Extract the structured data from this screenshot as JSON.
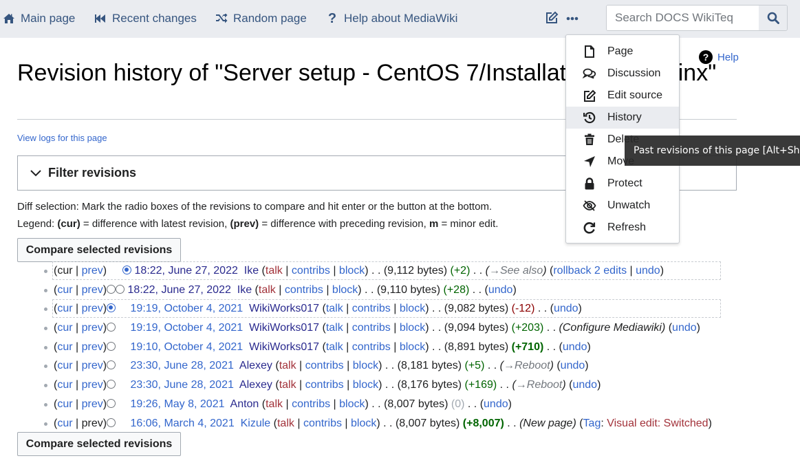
{
  "nav": {
    "links": [
      {
        "label": "Main page",
        "icon": "home-icon"
      },
      {
        "label": "Recent changes",
        "icon": "backward-icon"
      },
      {
        "label": "Random page",
        "icon": "shuffle-icon"
      },
      {
        "label": "Help about MediaWiki",
        "icon": "question-icon"
      }
    ],
    "search_placeholder": "Search DOCS WikiTeq"
  },
  "page": {
    "title": "Revision history of \"Server setup - CentOS 7/Installation with nginx\"",
    "view_logs": "View logs for this page",
    "help": "Help",
    "filter_label": "Filter revisions",
    "diff_info": "Diff selection: Mark the radio boxes of the revisions to compare and hit enter or the button at the bottom.",
    "legend": {
      "prefix": "Legend: ",
      "cur": "(cur)",
      "cur_desc": " = difference with latest revision, ",
      "prev": "(prev)",
      "prev_desc": " = difference with preceding revision, ",
      "m": "m",
      "m_desc": " = minor edit."
    },
    "compare_button": "Compare selected revisions"
  },
  "revisions": [
    {
      "cur": "cur",
      "prev": "prev",
      "date": "18:22, June 27, 2022",
      "user": "Ike",
      "talk": "talk",
      "contribs": "contribs",
      "block": "block",
      "size": "(9,112 bytes)",
      "diff": "(+2)",
      "diff_type": "pos",
      "summary": "→See also",
      "summary_type": "section",
      "actions": [
        "rollback 2 edits",
        "undo"
      ],
      "radio_old": false,
      "radio_new": true,
      "selected": true,
      "cur_link": false,
      "prev_link": true
    },
    {
      "cur": "cur",
      "prev": "prev",
      "date": "18:22, June 27, 2022",
      "user": "Ike",
      "talk": "talk",
      "contribs": "contribs",
      "block": "block",
      "size": "(9,110 bytes)",
      "diff": "(+28)",
      "diff_type": "pos",
      "summary": "",
      "summary_type": "",
      "actions": [
        "undo"
      ],
      "radio_old": false,
      "radio_new": false,
      "selected": false,
      "cur_link": true,
      "prev_link": true
    },
    {
      "cur": "cur",
      "prev": "prev",
      "date": "19:19, October 4, 2021",
      "user": "WikiWorks017",
      "talk": "talk",
      "contribs": "contribs",
      "block": "block",
      "size": "(9,082 bytes)",
      "diff": "(-12)",
      "diff_type": "neg",
      "summary": "",
      "summary_type": "",
      "actions": [
        "undo"
      ],
      "radio_old": true,
      "radio_new": null,
      "selected": true,
      "cur_link": true,
      "prev_link": true
    },
    {
      "cur": "cur",
      "prev": "prev",
      "date": "19:19, October 4, 2021",
      "user": "WikiWorks017",
      "talk": "talk",
      "contribs": "contribs",
      "block": "block",
      "size": "(9,094 bytes)",
      "diff": "(+203)",
      "diff_type": "pos",
      "summary": "Configure Mediawiki",
      "summary_type": "plain",
      "actions": [
        "undo"
      ],
      "radio_old": false,
      "radio_new": null,
      "selected": false,
      "cur_link": true,
      "prev_link": true
    },
    {
      "cur": "cur",
      "prev": "prev",
      "date": "19:10, October 4, 2021",
      "user": "WikiWorks017",
      "talk": "talk",
      "contribs": "contribs",
      "block": "block",
      "size": "(8,891 bytes)",
      "diff": "(+710)",
      "diff_type": "posb",
      "summary": "",
      "summary_type": "",
      "actions": [
        "undo"
      ],
      "radio_old": false,
      "radio_new": null,
      "selected": false,
      "cur_link": true,
      "prev_link": true
    },
    {
      "cur": "cur",
      "prev": "prev",
      "date": "23:30, June 28, 2021",
      "user": "Alexey",
      "talk": "talk",
      "contribs": "contribs",
      "block": "block",
      "size": "(8,181 bytes)",
      "diff": "(+5)",
      "diff_type": "pos",
      "summary": "→Reboot",
      "summary_type": "section",
      "actions": [
        "undo"
      ],
      "radio_old": false,
      "radio_new": null,
      "selected": false,
      "cur_link": true,
      "prev_link": true
    },
    {
      "cur": "cur",
      "prev": "prev",
      "date": "23:30, June 28, 2021",
      "user": "Alexey",
      "talk": "talk",
      "contribs": "contribs",
      "block": "block",
      "size": "(8,176 bytes)",
      "diff": "(+169)",
      "diff_type": "pos",
      "summary": "→Reboot",
      "summary_type": "section",
      "actions": [
        "undo"
      ],
      "radio_old": false,
      "radio_new": null,
      "selected": false,
      "cur_link": true,
      "prev_link": true
    },
    {
      "cur": "cur",
      "prev": "prev",
      "date": "19:26, May 8, 2021",
      "user": "Anton",
      "talk": "talk",
      "contribs": "contribs",
      "block": "block",
      "size": "(8,007 bytes)",
      "diff": "(0)",
      "diff_type": "nul",
      "summary": "",
      "summary_type": "",
      "actions": [
        "undo"
      ],
      "radio_old": false,
      "radio_new": null,
      "selected": false,
      "cur_link": true,
      "prev_link": true
    },
    {
      "cur": "cur",
      "prev": "prev",
      "date": "16:06, March 4, 2021",
      "user": "Kizule",
      "talk": "talk",
      "contribs": "contribs",
      "block": "block",
      "size": "(8,007 bytes)",
      "diff": "(+8,007)",
      "diff_type": "posb",
      "summary": "New page",
      "summary_type": "plain",
      "actions": [],
      "tag_label": "Tag",
      "tag_value": "Visual edit: Switched",
      "radio_old": false,
      "radio_new": null,
      "selected": false,
      "cur_link": true,
      "prev_link": false
    }
  ],
  "menu": {
    "items": [
      {
        "label": "Page",
        "icon": "page-icon"
      },
      {
        "label": "Discussion",
        "icon": "discussion-icon"
      },
      {
        "label": "Edit source",
        "icon": "edit-icon"
      },
      {
        "label": "History",
        "icon": "history-icon",
        "active": true
      },
      {
        "label": "Delete",
        "icon": "trash-icon"
      },
      {
        "label": "Move",
        "icon": "move-icon"
      },
      {
        "label": "Protect",
        "icon": "lock-icon"
      },
      {
        "label": "Unwatch",
        "icon": "unwatch-icon"
      },
      {
        "label": "Refresh",
        "icon": "refresh-icon"
      }
    ]
  },
  "tooltip": "Past revisions of this page [Alt+Shift+h]",
  "colors": {
    "link": "#3366cc",
    "nav_link": "#36557f",
    "talk_link": "#a2323a",
    "positive_diff": "#006400",
    "negative_diff": "#8b0000",
    "topbar_bg": "#eaecf0"
  }
}
